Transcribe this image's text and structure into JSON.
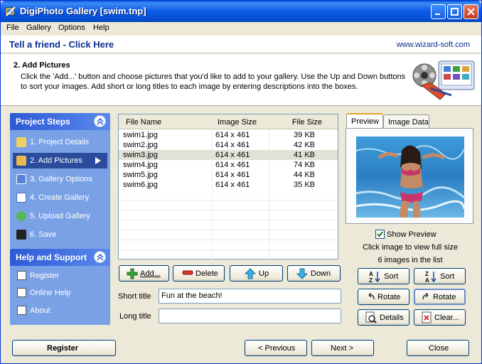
{
  "window": {
    "title": "DigiPhoto Gallery  [swim.tnp]"
  },
  "menu": [
    "File",
    "Gallery",
    "Options",
    "Help"
  ],
  "friendbar": {
    "link": "Tell a friend - Click Here",
    "site": "www.wizard-soft.com"
  },
  "header": {
    "title": "2. Add Pictures",
    "description": "Click the 'Add...' button and choose pictures that you'd like to add to your gallery.  Use the Up and Down buttons to sort your images.  Add short or long titles to each image by entering descriptions into the boxes."
  },
  "project_steps": {
    "title": "Project Steps",
    "items": [
      {
        "label": "1. Project Details"
      },
      {
        "label": "2. Add Pictures",
        "active": true
      },
      {
        "label": "3. Gallery Options"
      },
      {
        "label": "4. Create Gallery"
      },
      {
        "label": "5. Upload Gallery"
      },
      {
        "label": "6. Save"
      }
    ]
  },
  "help_support": {
    "title": "Help and Support",
    "items": [
      {
        "label": "Register"
      },
      {
        "label": "Online Help"
      },
      {
        "label": "About"
      }
    ]
  },
  "file_list": {
    "columns": [
      "File Name",
      "Image Size",
      "File Size"
    ],
    "rows": [
      {
        "name": "swim1.jpg",
        "size": "614 x 461",
        "file_size": "39 KB"
      },
      {
        "name": "swim2.jpg",
        "size": "614 x 461",
        "file_size": "42 KB"
      },
      {
        "name": "swim3.jpg",
        "size": "614 x 461",
        "file_size": "41 KB",
        "selected": true
      },
      {
        "name": "swim4.jpg",
        "size": "614 x 461",
        "file_size": "74 KB"
      },
      {
        "name": "swim5.jpg",
        "size": "614 x 461",
        "file_size": "44 KB"
      },
      {
        "name": "swim6.jpg",
        "size": "614 x 461",
        "file_size": "35 KB"
      }
    ]
  },
  "list_buttons": {
    "add": "Add...",
    "delete": "Delete",
    "up": "Up",
    "down": "Down"
  },
  "fields": {
    "short_label": "Short title",
    "short_value": "Fun at the beach!",
    "long_label": "Long title",
    "long_value": ""
  },
  "preview": {
    "tabs": [
      "Preview",
      "Image Data"
    ],
    "show_preview": "Show Preview",
    "hint": "Click image to view full size",
    "count": "6 images in the list"
  },
  "side_buttons": {
    "sort_az": "Sort",
    "sort_za": "Sort",
    "rotate_left": "Rotate",
    "rotate_right": "Rotate",
    "details": "Details",
    "clear": "Clear..."
  },
  "footer": {
    "register": "Register",
    "previous": "< Previous",
    "next": "Next >",
    "close": "Close"
  }
}
